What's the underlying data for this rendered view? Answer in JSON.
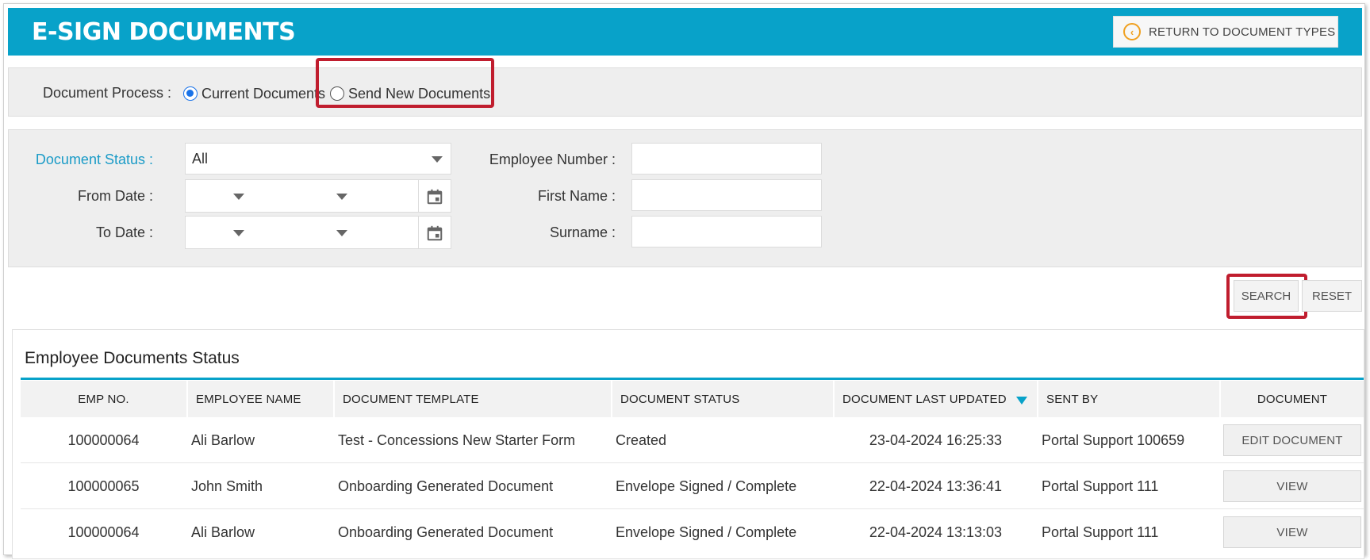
{
  "header": {
    "title": "E-SIGN DOCUMENTS",
    "return_button": "RETURN TO DOCUMENT TYPES"
  },
  "process": {
    "label": "Document Process :",
    "options": [
      {
        "label": "Current Documents",
        "selected": true
      },
      {
        "label": "Send New Documents",
        "selected": false
      }
    ]
  },
  "filters": {
    "document_status_label": "Document Status :",
    "document_status_value": "All",
    "from_date_label": "From Date :",
    "to_date_label": "To Date :",
    "employee_number_label": "Employee Number :",
    "first_name_label": "First Name :",
    "surname_label": "Surname :"
  },
  "actions": {
    "search": "SEARCH",
    "reset": "RESET"
  },
  "table": {
    "title": "Employee Documents Status",
    "columns": [
      "EMP NO.",
      "EMPLOYEE NAME",
      "DOCUMENT TEMPLATE",
      "DOCUMENT STATUS",
      "DOCUMENT LAST UPDATED",
      "SENT BY",
      "DOCUMENT"
    ],
    "rows": [
      {
        "emp_no": "100000064",
        "name": "Ali Barlow",
        "template": "Test - Concessions New Starter Form",
        "status": "Created",
        "updated": "23-04-2024 16:25:33",
        "sent_by": "Portal Support 100659",
        "action": "EDIT DOCUMENT"
      },
      {
        "emp_no": "100000065",
        "name": "John Smith",
        "template": "Onboarding Generated Document",
        "status": "Envelope Signed / Complete",
        "updated": "22-04-2024 13:36:41",
        "sent_by": "Portal Support 111",
        "action": "VIEW"
      },
      {
        "emp_no": "100000064",
        "name": "Ali Barlow",
        "template": "Onboarding Generated Document",
        "status": "Envelope Signed / Complete",
        "updated": "22-04-2024 13:13:03",
        "sent_by": "Portal Support 111",
        "action": "VIEW"
      }
    ]
  },
  "colors": {
    "header": "#08a2c9",
    "highlight": "#c01d2e",
    "accent_icon": "#f0a020",
    "radio": "#1a73e8"
  },
  "icons": [
    "chevron-left-circle-icon",
    "calendar-icon",
    "dropdown-caret-icon",
    "sort-desc-icon"
  ]
}
